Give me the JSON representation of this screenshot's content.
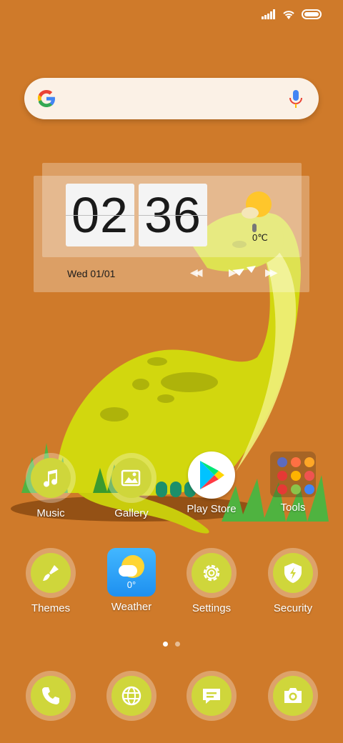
{
  "clock": {
    "hours": "02",
    "minutes": "36",
    "date": "Wed 01/01",
    "temperature": "0℃"
  },
  "dock_row": [
    {
      "label": "Music",
      "icon": "music-note-icon"
    },
    {
      "label": "Gallery",
      "icon": "image-icon"
    },
    {
      "label": "Play Store",
      "icon": "play-store-icon"
    },
    {
      "label": "Tools",
      "icon": "folder-icon"
    }
  ],
  "apps_row": [
    {
      "label": "Themes",
      "icon": "paintbrush-icon"
    },
    {
      "label": "Weather",
      "icon": "weather-icon",
      "value": "0°"
    },
    {
      "label": "Settings",
      "icon": "gear-icon"
    },
    {
      "label": "Security",
      "icon": "shield-icon"
    }
  ],
  "dock": [
    {
      "icon": "phone-icon"
    },
    {
      "icon": "globe-icon"
    },
    {
      "icon": "message-icon"
    },
    {
      "icon": "camera-icon"
    }
  ],
  "colors": {
    "background": "#cf7a2a",
    "accent_green": "#cfd63b",
    "dino": "#d4d90f"
  }
}
